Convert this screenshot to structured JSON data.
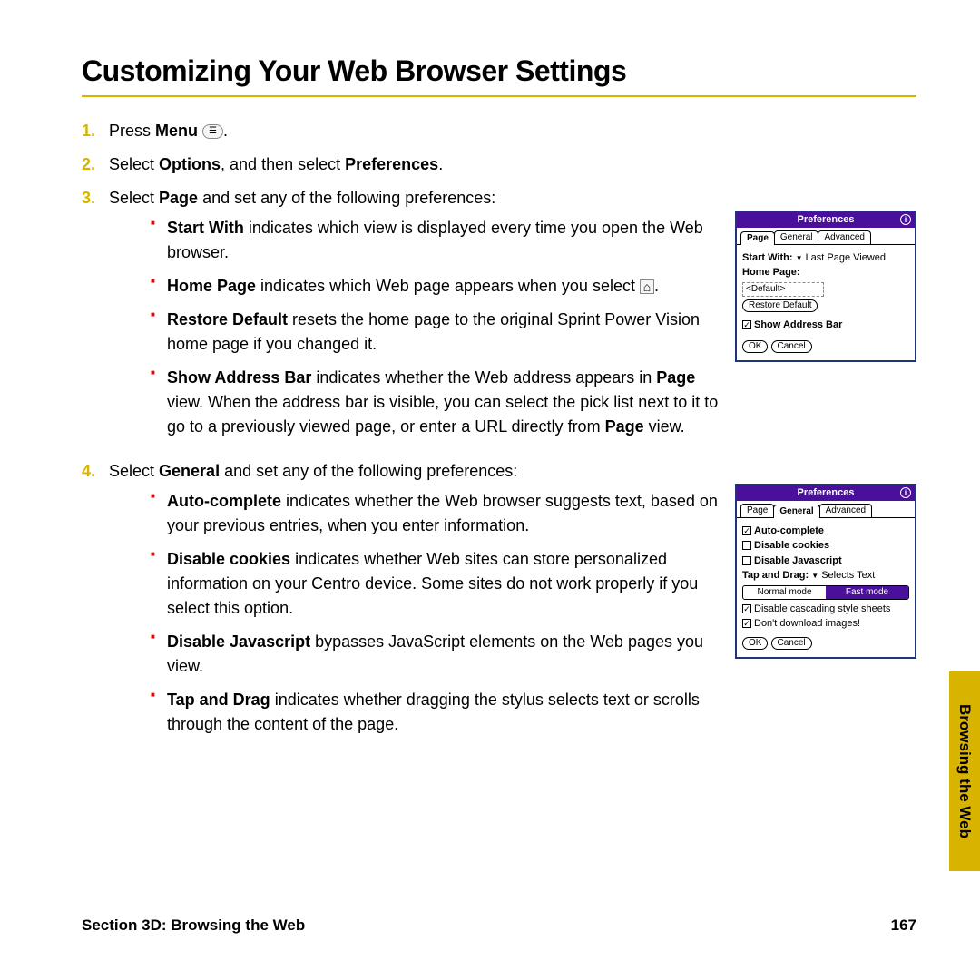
{
  "heading": "Customizing Your Web Browser Settings",
  "steps": {
    "s1_press": "Press ",
    "s1_bold": "Menu",
    "s1_after": " ",
    "s1_end": ".",
    "s2_a": "Select ",
    "s2_b": "Options",
    "s2_c": ", and then select ",
    "s2_d": "Preferences",
    "s2_e": ".",
    "s3_a": "Select ",
    "s3_b": "Page",
    "s3_c": " and set any of the following preferences:",
    "s4_a": "Select ",
    "s4_b": "General",
    "s4_c": " and set any of the following preferences:"
  },
  "bul3": {
    "b1_a": "Start With",
    "b1_b": " indicates which view is displayed every time you open the Web browser.",
    "b2_a": "Home Page",
    "b2_b": " indicates which Web page appears when you select ",
    "b2_c": ".",
    "b3_a": "Restore Default",
    "b3_b": " resets the home page to the original Sprint Power Vision home page if you changed it.",
    "b4_a": "Show Address Bar",
    "b4_b": " indicates whether the Web address appears in ",
    "b4_c": "Page",
    "b4_d": " view. When the address bar is visible, you can select the pick list next to it to go to a previously viewed page, or enter a URL directly from ",
    "b4_e": "Page",
    "b4_f": " view."
  },
  "bul4": {
    "b1_a": "Auto-complete",
    "b1_b": " indicates whether the Web browser suggests text, based on your previous entries, when you enter information.",
    "b2_a": "Disable cookies",
    "b2_b": " indicates whether Web sites can store personalized information on your Centro device. Some sites do not work properly if you select this option.",
    "b3_a": "Disable Javascript",
    "b3_b": " bypasses JavaScript elements on the Web pages you view.",
    "b4_a": "Tap and Drag",
    "b4_b": " indicates whether dragging the stylus selects text or scrolls through the content of the page."
  },
  "shot1": {
    "title": "Preferences",
    "tab_page": "Page",
    "tab_general": "General",
    "tab_advanced": "Advanced",
    "start_with_label": "Start With:",
    "start_with_value": "Last Page Viewed",
    "home_page_label": "Home Page:",
    "default_field": "<Default>",
    "restore_btn": "Restore Default",
    "show_addr": "Show Address Bar",
    "ok": "OK",
    "cancel": "Cancel"
  },
  "shot2": {
    "title": "Preferences",
    "tab_page": "Page",
    "tab_general": "General",
    "tab_advanced": "Advanced",
    "auto": "Auto-complete",
    "dcook": "Disable cookies",
    "djs": "Disable Javascript",
    "tad_label": "Tap and Drag:",
    "tad_value": "Selects Text",
    "normal_mode": "Normal mode",
    "fast_mode": "Fast mode",
    "dcss": "Disable cascading style sheets",
    "dimg": "Don't download images!",
    "ok": "OK",
    "cancel": "Cancel"
  },
  "footer": {
    "left": "Section 3D: Browsing the Web",
    "right": "167"
  },
  "sidetab": "Browsing the Web",
  "menu_key": "☰"
}
